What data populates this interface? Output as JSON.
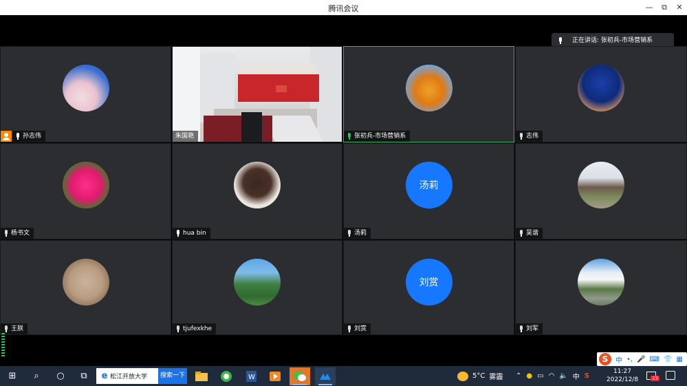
{
  "window": {
    "title": "腾讯会议",
    "minimize": "—",
    "maximize": "⧉",
    "close": "✕"
  },
  "speaking": {
    "label": "正在讲话: 张初兵-市场营销系"
  },
  "tiles": [
    {
      "name": "孙志伟",
      "avatar": "sakura",
      "host": true,
      "mic": "on"
    },
    {
      "name": "朱国艳",
      "avatar": "video",
      "mic": "none"
    },
    {
      "name": "张初兵-市场营销系",
      "avatar": "autumn",
      "mic": "speaking",
      "active": true
    },
    {
      "name": "志伟",
      "avatar": "night",
      "mic": "muted"
    },
    {
      "name": "杨书文",
      "avatar": "flower",
      "mic": "muted"
    },
    {
      "name": "hua bin",
      "avatar": "carving",
      "mic": "on"
    },
    {
      "name": "汤莉",
      "avatar_text": "汤莉",
      "mic": "muted"
    },
    {
      "name": "吴谐",
      "avatar": "park",
      "mic": "muted"
    },
    {
      "name": "王朕",
      "avatar": "stone",
      "mic": "muted"
    },
    {
      "name": "tjufexkhe",
      "avatar": "valley",
      "mic": "muted"
    },
    {
      "name": "刘赏",
      "avatar_text": "刘赏",
      "mic": "muted"
    },
    {
      "name": "刘军",
      "avatar": "road",
      "mic": "muted"
    }
  ],
  "ime": {
    "logo": "S",
    "mode": "中",
    "punct": "•,"
  },
  "taskbar": {
    "search_text": "松江开放大学",
    "search_button": "搜索一下",
    "weather_temp": "5°C",
    "weather_desc": "雾霾",
    "input_method": "中",
    "time": "11:27",
    "date": "2022/12/8",
    "notif_count": "29"
  }
}
